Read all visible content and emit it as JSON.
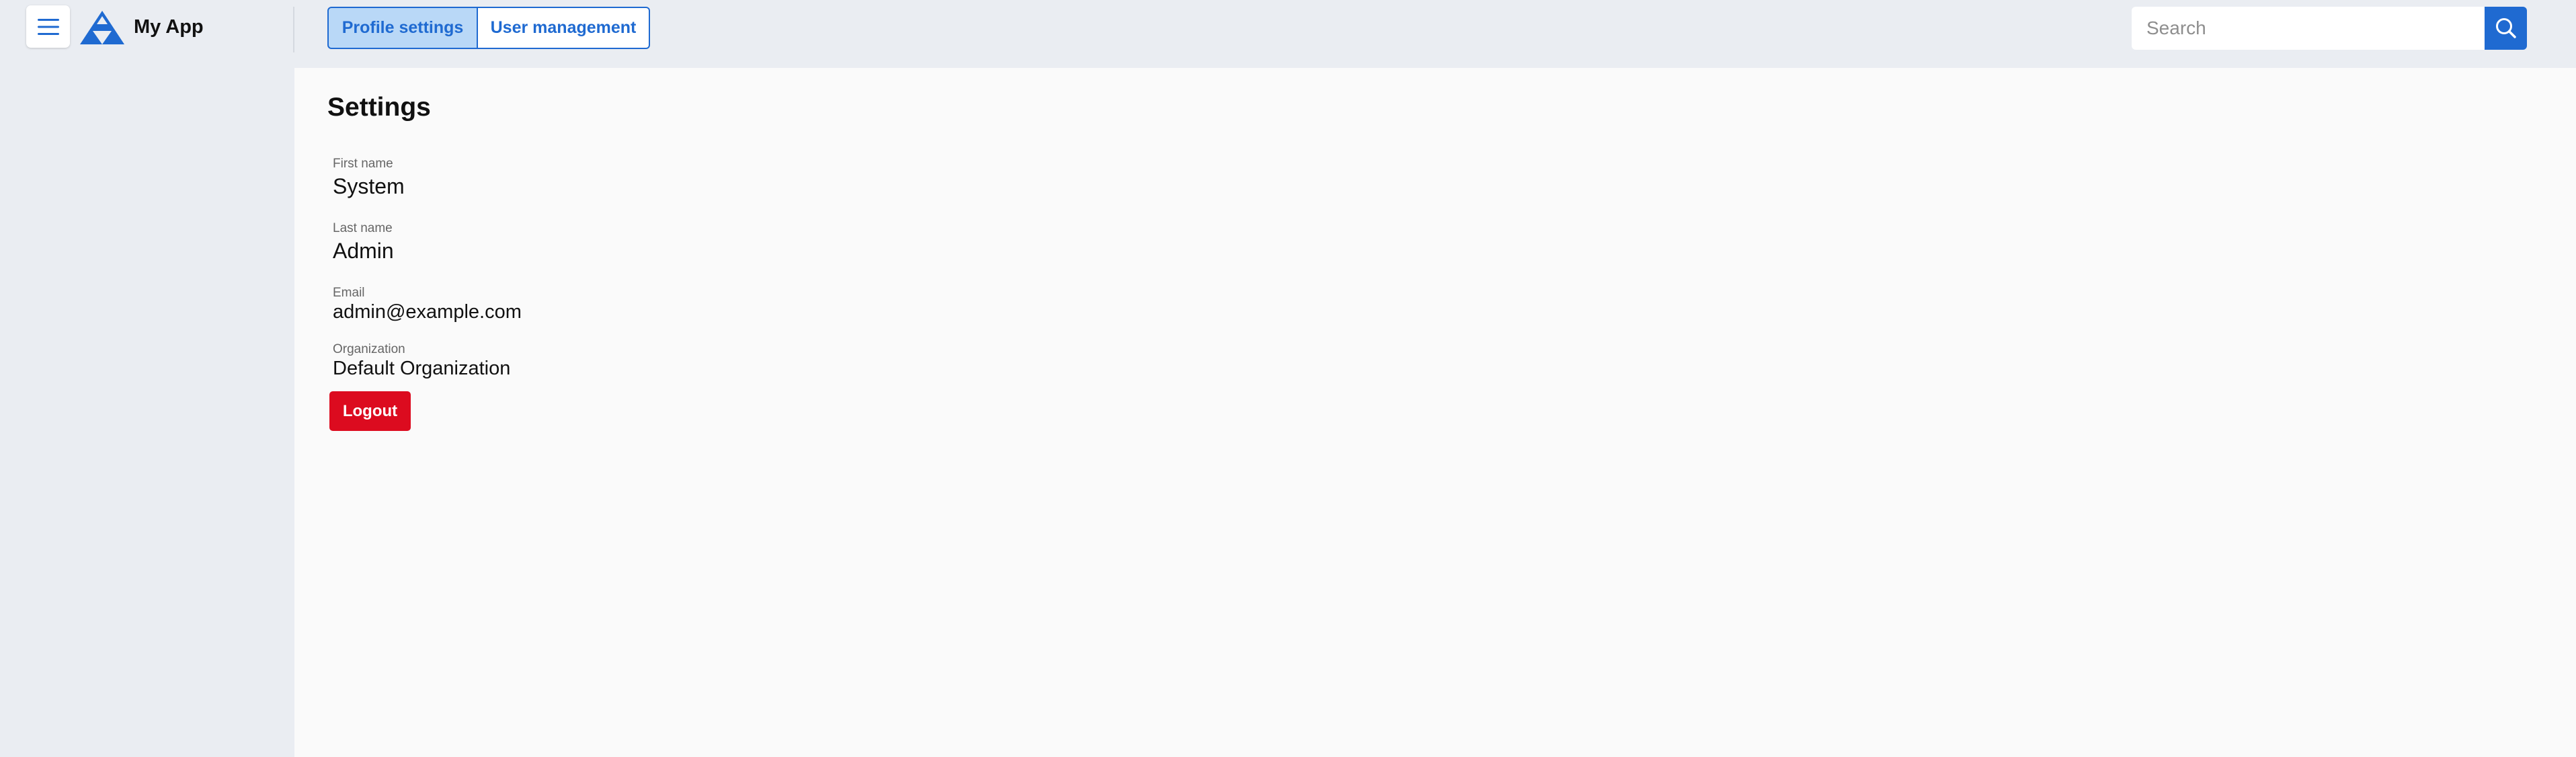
{
  "header": {
    "app_name": "My App",
    "menu_icon": "hamburger-menu-icon",
    "logo_icon": "triangle-logo-icon",
    "brand_color": "#1f6ad1"
  },
  "tabs": [
    {
      "label": "Profile settings",
      "active": true
    },
    {
      "label": "User management",
      "active": false
    }
  ],
  "search": {
    "placeholder": "Search",
    "value": "",
    "icon": "search-icon"
  },
  "main": {
    "title": "Settings",
    "fields": [
      {
        "label": "First name",
        "value": "System"
      },
      {
        "label": "Last name",
        "value": "Admin"
      },
      {
        "label": "Email",
        "value": "admin@example.com"
      },
      {
        "label": "Organization",
        "value": "Default Organization"
      }
    ],
    "logout_label": "Logout",
    "logout_color": "#dc0b1f"
  }
}
